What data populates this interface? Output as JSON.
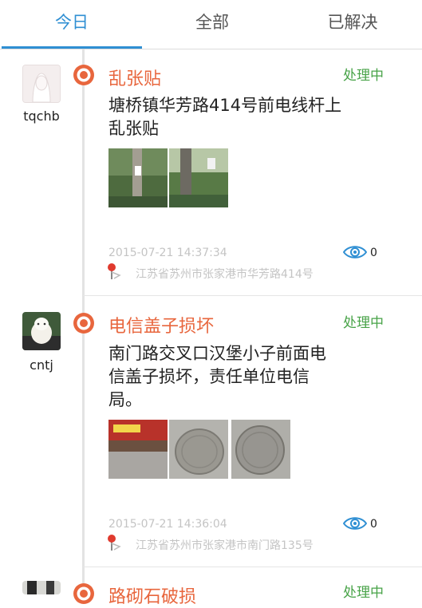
{
  "tabs": [
    {
      "label": "今日",
      "active": true
    },
    {
      "label": "全部",
      "active": false
    },
    {
      "label": "已解决",
      "active": false
    }
  ],
  "colors": {
    "accent": "#2f8fd3",
    "title": "#e8663d",
    "status": "#48a348"
  },
  "cards": [
    {
      "username": "tqchb",
      "title": "乱张贴",
      "status": "处理中",
      "description": "塘桥镇华芳路414号前电线杆上乱张贴",
      "time": "2015-07-21 14:37:34",
      "address": "江苏省苏州市张家港市华芳路414号",
      "views": "0",
      "photo_count": 2
    },
    {
      "username": "cntj",
      "title": "电信盖子损坏",
      "status": "处理中",
      "description": "南门路交叉口汉堡小子前面电信盖子损坏，责任单位电信局。",
      "time": "2015-07-21 14:36:04",
      "address": "江苏省苏州市张家港市南门路135号",
      "views": "0",
      "photo_count": 3
    },
    {
      "title": "路砌石破损",
      "status": "处理中"
    }
  ]
}
